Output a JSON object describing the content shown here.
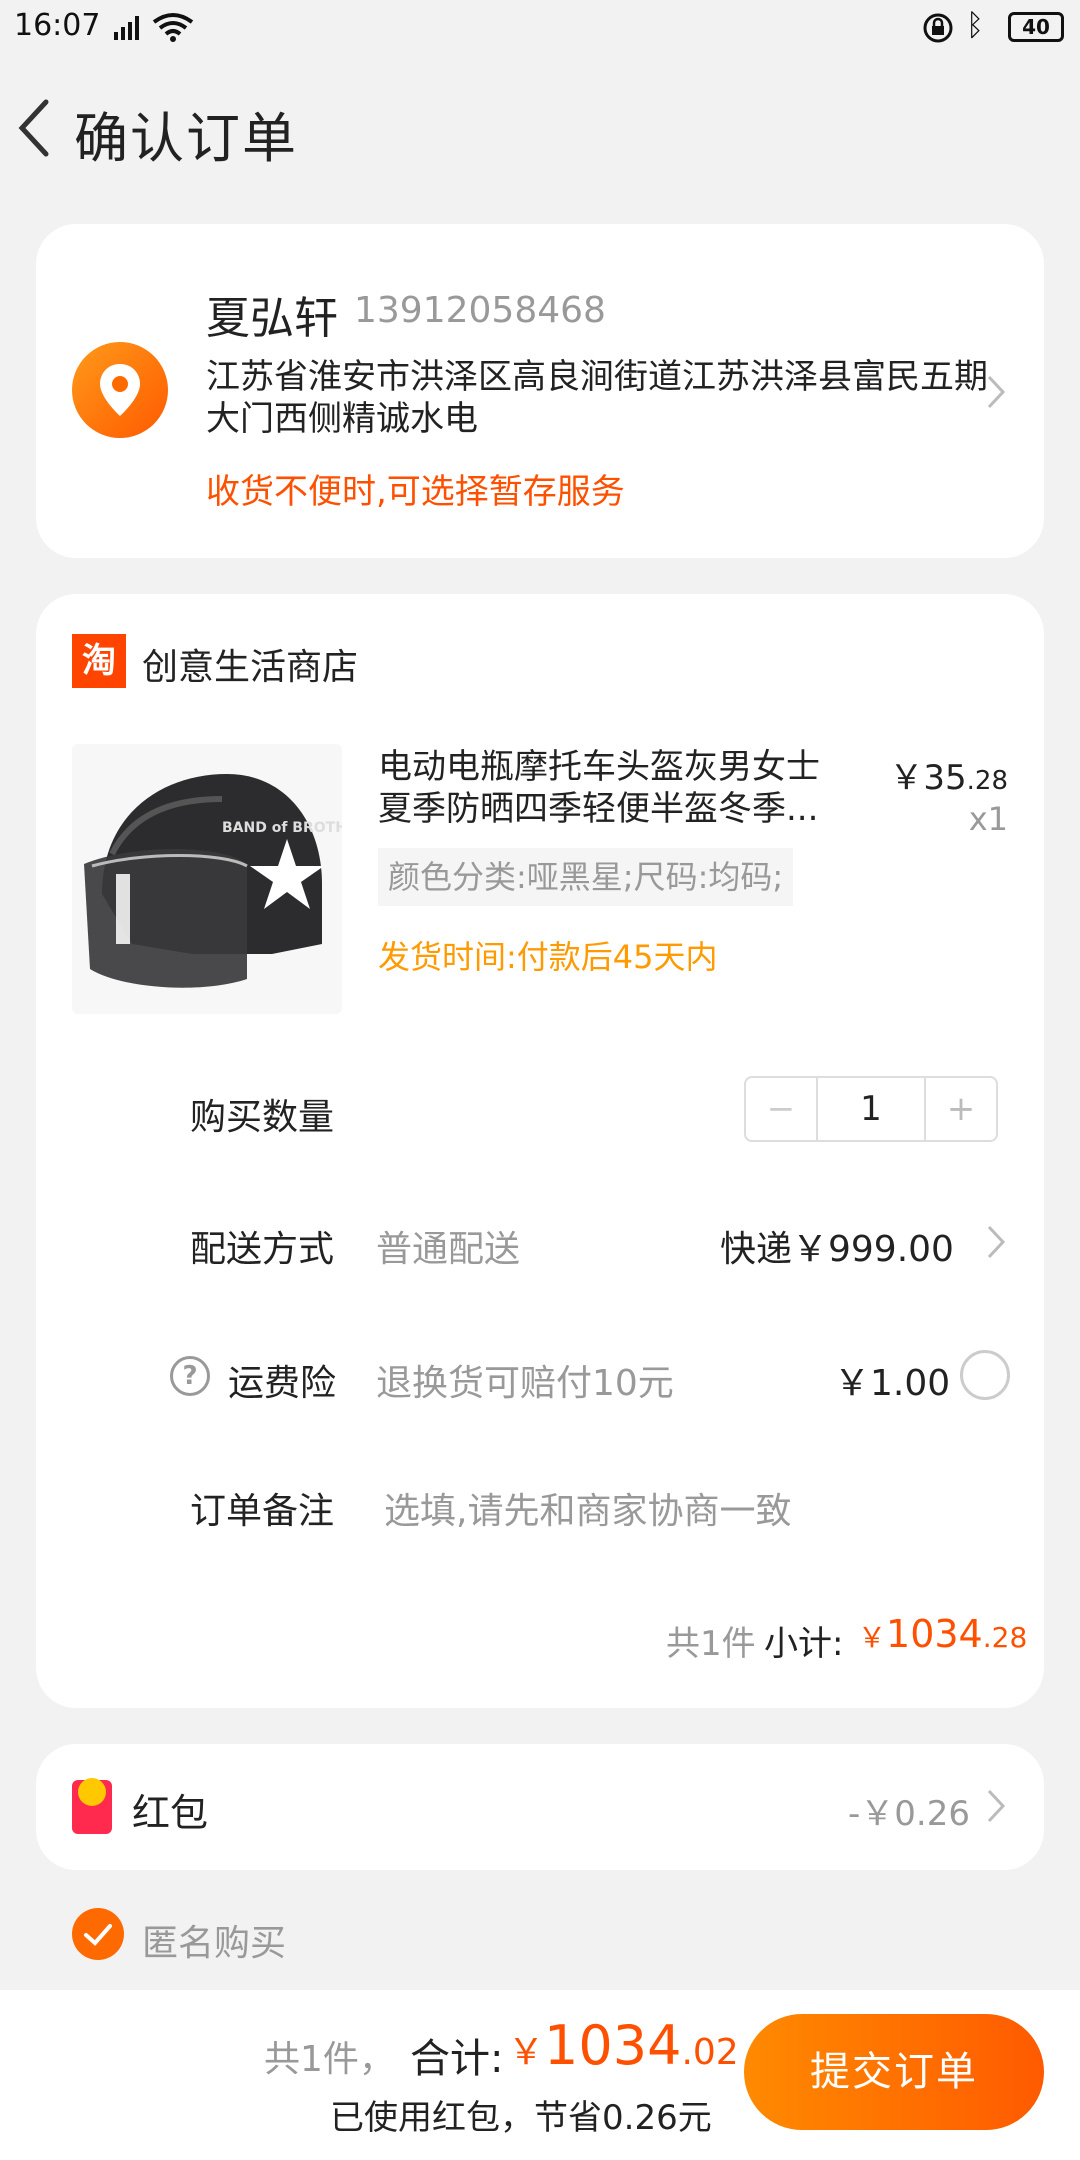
{
  "status_bar": {
    "time": "16:07",
    "network": "4G",
    "battery": "40"
  },
  "header": {
    "title": "确认订单"
  },
  "address": {
    "name": "夏弘轩",
    "phone": "13912058468",
    "address": "江苏省淮安市洪泽区高良涧街道江苏洪泽县富民五期大门西侧精诚水电",
    "tip": "收货不便时,可选择暂存服务"
  },
  "shop": {
    "icon_text": "淘",
    "name": "创意生活商店"
  },
  "product": {
    "title": "电动电瓶摩托车头盔灰男女士夏季防晒四季轻便半盔冬季...",
    "price_main": "￥35",
    "price_dec": ".28",
    "qty": "x1",
    "sku": "颜色分类:哑黑星;尺码:均码;",
    "ship_time": "发货时间:付款后45天内",
    "image_text": "BAND of BROTHERS"
  },
  "quantity": {
    "label": "购买数量",
    "minus": "−",
    "value": "1",
    "plus": "+"
  },
  "delivery": {
    "label": "配送方式",
    "method": "普通配送",
    "price": "快递￥999.00"
  },
  "insurance": {
    "label": "运费险",
    "desc": "退换货可赔付10元",
    "price": "￥1.00",
    "help": "?"
  },
  "remark": {
    "label": "订单备注",
    "placeholder": "选填,请先和商家协商一致"
  },
  "subtotal": {
    "count": "共1件",
    "label": "小计:",
    "cur": "￥",
    "main": "1034",
    "dec": ".28"
  },
  "red_packet": {
    "label": "红包",
    "value": "-￥0.26"
  },
  "anonymous": {
    "label": "匿名购买"
  },
  "bottom": {
    "count": "共1件，",
    "label": "合计:",
    "cur": "￥",
    "main": "1034",
    "dec": ".02",
    "note": "已使用红包，节省0.26元",
    "submit": "提交订单"
  },
  "colors": {
    "accent": "#ff5000",
    "gold": "#ff9a00"
  }
}
